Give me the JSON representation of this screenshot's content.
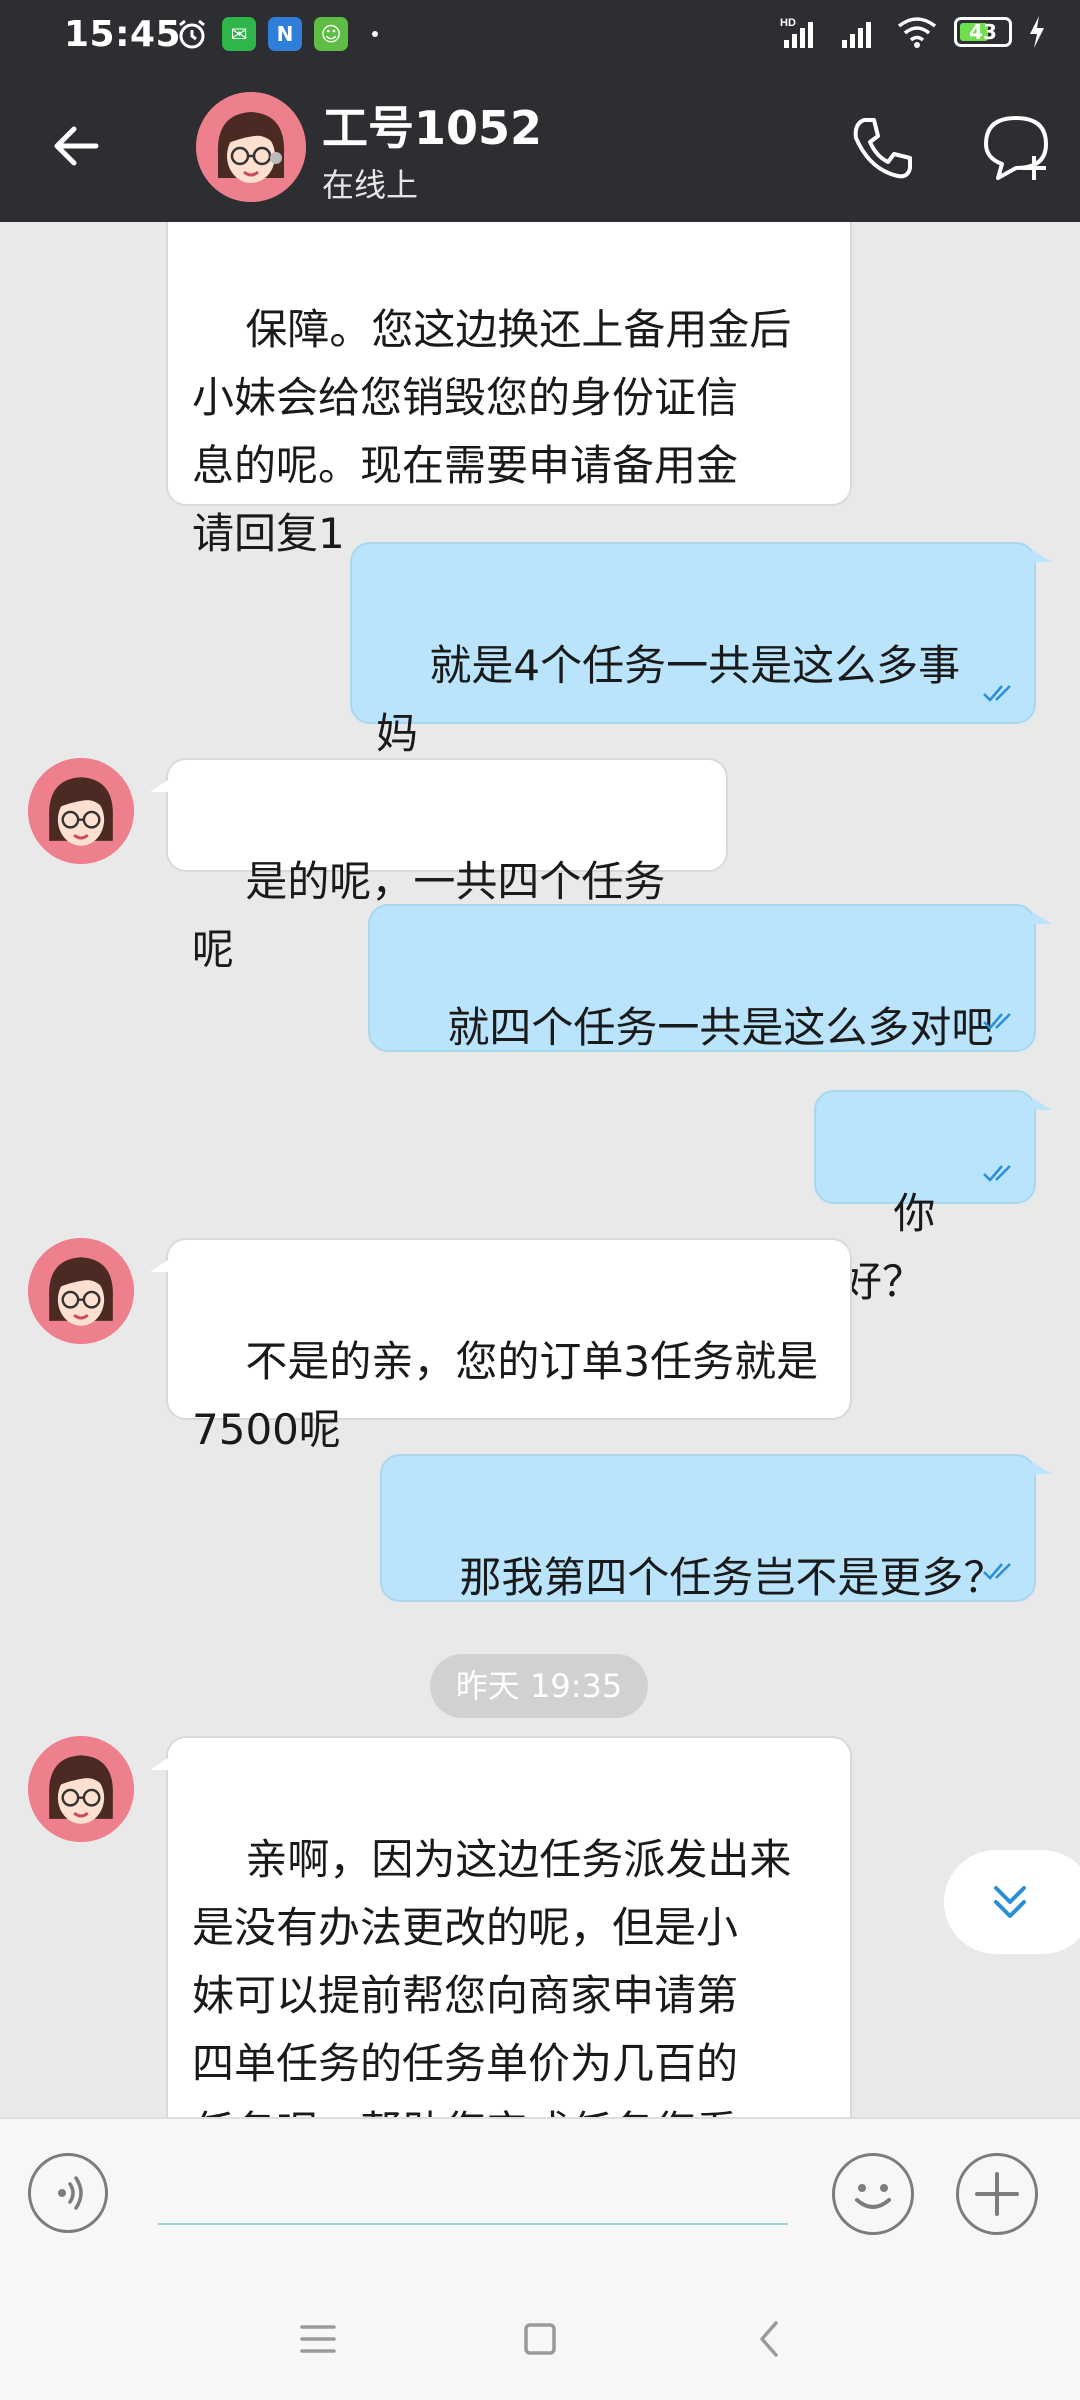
{
  "status_bar": {
    "time": "15:45",
    "battery": "43",
    "network": "HD"
  },
  "header": {
    "contact_name": "工号1052",
    "status": "在线上"
  },
  "messages": [
    {
      "side": "in",
      "text": "保障。您这边换还上备用金后\n小妹会给您销毁您的身份证信\n息的呢。现在需要申请备用金\n请回复1"
    },
    {
      "side": "out",
      "text": "就是4个任务一共是这么多事\n妈"
    },
    {
      "side": "in",
      "text": "是的呢，一共四个任务呢"
    },
    {
      "side": "out",
      "text": "就四个任务一共是这么多对吧"
    },
    {
      "side": "out",
      "text": "你好？"
    },
    {
      "side": "in",
      "text": "不是的亲，您的订单3任务就是\n7500呢"
    },
    {
      "side": "out",
      "text": "那我第四个任务岂不是更多？"
    },
    {
      "side": "in",
      "text": "亲啊，因为这边任务派发出来\n是没有办法更改的呢，但是小\n妹可以提前帮您向商家申请第\n四单任务的任务单价为几百的\n任务呢，帮助您完成任务您看\n可以吗"
    }
  ],
  "timestamp": "昨天 19:35",
  "input": {
    "placeholder": ""
  },
  "colors": {
    "header_bg": "#2d2e32",
    "chat_bg": "#e9e9e9",
    "out_bubble": "#b9e4fb",
    "read_tick": "#2a8fd6",
    "avatar_bg": "#ee7f8d"
  }
}
